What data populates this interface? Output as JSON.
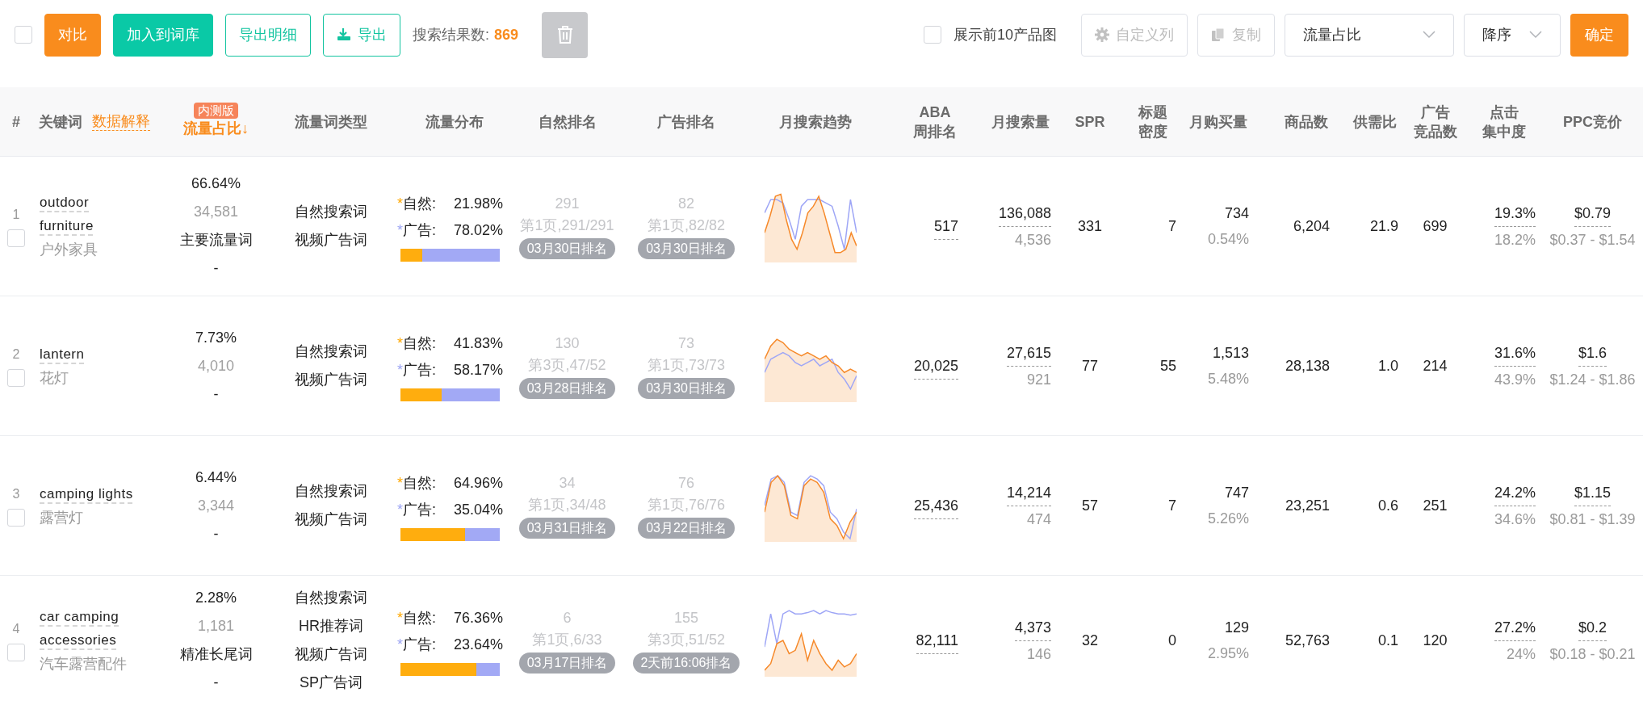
{
  "toolbar": {
    "select_all": {
      "checked": false
    },
    "left_buttons": [
      {
        "label": "对比",
        "kind": "orange"
      },
      {
        "label": "加入到词库",
        "kind": "teal"
      },
      {
        "label": "导出明细",
        "kind": "outline"
      },
      {
        "label": "导出",
        "kind": "outline-download"
      }
    ],
    "result_label": "搜索结果数:",
    "result_count": "869",
    "delete_button": {
      "disabled": true
    },
    "show_images": {
      "label": "展示前10产品图",
      "checked": false
    },
    "right_buttons": [
      {
        "label": "自定义列",
        "kind": "settings",
        "disabled": true
      },
      {
        "label": "复制",
        "kind": "copy",
        "disabled": true
      }
    ],
    "selects": [
      {
        "value": "流量占比"
      },
      {
        "value": "降序"
      }
    ],
    "confirm_button": {
      "label": "确定"
    }
  },
  "table": {
    "columns": [
      {
        "lines": [
          "#"
        ],
        "sorted": false
      },
      {
        "lines": [
          "关键词"
        ],
        "link": "数据解释",
        "sorted": false
      },
      {
        "lines": [
          "流量占比↓"
        ],
        "badge": "内测版",
        "sorted": true
      },
      {
        "lines": [
          "流量词类型"
        ],
        "sorted": false
      },
      {
        "lines": [
          "流量分布"
        ],
        "sorted": false
      },
      {
        "lines": [
          "自然排名"
        ],
        "sorted": false
      },
      {
        "lines": [
          "广告排名"
        ],
        "sorted": false
      },
      {
        "lines": [
          "月搜索趋势"
        ],
        "sorted": false
      },
      {
        "lines": [
          "ABA",
          "周排名"
        ],
        "sorted": false
      },
      {
        "lines": [
          "月搜索量"
        ],
        "sorted": false
      },
      {
        "lines": [
          "SPR"
        ],
        "sorted": false
      },
      {
        "lines": [
          "标题",
          "密度"
        ],
        "sorted": false
      },
      {
        "lines": [
          "月购买量"
        ],
        "sorted": false
      },
      {
        "lines": [
          "商品数"
        ],
        "sorted": false
      },
      {
        "lines": [
          "供需比"
        ],
        "sorted": false
      },
      {
        "lines": [
          "广告",
          "竞品数"
        ],
        "sorted": false
      },
      {
        "lines": [
          "点击",
          "集中度"
        ],
        "sorted": false
      },
      {
        "lines": [
          "PPC竞价"
        ],
        "sorted": false
      }
    ],
    "rows": [
      {
        "index": "1",
        "checked": false,
        "keyword": "outdoor furniture",
        "translation": "户外家具",
        "share": "66.64%",
        "share_count": "34,581",
        "share_type": "主要流量词",
        "share_extra": "-",
        "traffic_types": [
          "自然搜索词",
          "视频广告词"
        ],
        "distribution": {
          "level": 0.2198,
          "items": [
            {
              "kind": "natural",
              "marker": "*",
              "label": "自然:",
              "value": "21.98%"
            },
            {
              "kind": "ad",
              "marker": "*",
              "label": "广告:",
              "value": "78.02%"
            }
          ]
        },
        "organic_rank": {
          "rank": "291",
          "page": "第1页,291/291",
          "date": "03月30日排名"
        },
        "ad_rank": {
          "rank": "82",
          "page": "第1页,82/82",
          "date": "03月30日排名"
        },
        "aba": "517",
        "monthly_search": "136,088",
        "monthly_search_sub": "4,536",
        "spr": "331",
        "title_density": "7",
        "monthly_purchase": "734",
        "purchase_rate": "0.54%",
        "products": "6,204",
        "supply_demand": "21.9",
        "ad_products": "699",
        "click_share": "19.3%",
        "click_share_sub": "18.2%",
        "ppc": "$0.79",
        "ppc_range": "$0.37 - $1.54"
      },
      {
        "index": "2",
        "checked": false,
        "keyword": "lantern",
        "translation": "花灯",
        "share": "7.73%",
        "share_count": "4,010",
        "share_type": "",
        "share_extra": "-",
        "traffic_types": [
          "自然搜索词",
          "视频广告词"
        ],
        "distribution": {
          "level": 0.4183,
          "items": [
            {
              "kind": "natural",
              "marker": "*",
              "label": "自然:",
              "value": "41.83%"
            },
            {
              "kind": "ad",
              "marker": "*",
              "label": "广告:",
              "value": "58.17%"
            }
          ]
        },
        "organic_rank": {
          "rank": "130",
          "page": "第3页,47/52",
          "date": "03月28日排名"
        },
        "ad_rank": {
          "rank": "73",
          "page": "第1页,73/73",
          "date": "03月30日排名"
        },
        "aba": "20,025",
        "monthly_search": "27,615",
        "monthly_search_sub": "921",
        "spr": "77",
        "title_density": "55",
        "monthly_purchase": "1,513",
        "purchase_rate": "5.48%",
        "products": "28,138",
        "supply_demand": "1.0",
        "ad_products": "214",
        "click_share": "31.6%",
        "click_share_sub": "43.9%",
        "ppc": "$1.6",
        "ppc_range": "$1.24 - $1.86"
      },
      {
        "index": "3",
        "checked": false,
        "keyword": "camping lights",
        "translation": "露营灯",
        "share": "6.44%",
        "share_count": "3,344",
        "share_type": "",
        "share_extra": "-",
        "traffic_types": [
          "自然搜索词",
          "视频广告词"
        ],
        "distribution": {
          "level": 0.6496,
          "items": [
            {
              "kind": "natural",
              "marker": "*",
              "label": "自然:",
              "value": "64.96%"
            },
            {
              "kind": "ad",
              "marker": "*",
              "label": "广告:",
              "value": "35.04%"
            }
          ]
        },
        "organic_rank": {
          "rank": "34",
          "page": "第1页,34/48",
          "date": "03月31日排名"
        },
        "ad_rank": {
          "rank": "76",
          "page": "第1页,76/76",
          "date": "03月22日排名"
        },
        "aba": "25,436",
        "monthly_search": "14,214",
        "monthly_search_sub": "474",
        "spr": "57",
        "title_density": "7",
        "monthly_purchase": "747",
        "purchase_rate": "5.26%",
        "products": "23,251",
        "supply_demand": "0.6",
        "ad_products": "251",
        "click_share": "24.2%",
        "click_share_sub": "34.6%",
        "ppc": "$1.15",
        "ppc_range": "$0.81 - $1.39"
      },
      {
        "index": "4",
        "checked": false,
        "keyword": "car camping accessories",
        "translation": "汽车露营配件",
        "share": "2.28%",
        "share_count": "1,181",
        "share_type": "精准长尾词",
        "share_extra": "-",
        "traffic_types": [
          "自然搜索词",
          "HR推荐词",
          "视频广告词",
          "SP广告词"
        ],
        "distribution": {
          "level": 0.7636,
          "items": [
            {
              "kind": "natural",
              "marker": "*",
              "label": "自然:",
              "value": "76.36%"
            },
            {
              "kind": "ad",
              "marker": "*",
              "label": "广告:",
              "value": "23.64%"
            }
          ]
        },
        "organic_rank": {
          "rank": "6",
          "page": "第1页,6/33",
          "date": "03月17日排名"
        },
        "ad_rank": {
          "rank": "155",
          "page": "第3页,51/52",
          "date": "2天前16:06排名"
        },
        "aba": "82,111",
        "monthly_search": "4,373",
        "monthly_search_sub": "146",
        "spr": "32",
        "title_density": "0",
        "monthly_purchase": "129",
        "purchase_rate": "2.95%",
        "products": "52,763",
        "supply_demand": "0.1",
        "ad_products": "120",
        "click_share": "27.2%",
        "click_share_sub": "24%",
        "ppc": "$0.2",
        "ppc_range": "$0.18 - $0.21"
      }
    ]
  }
}
